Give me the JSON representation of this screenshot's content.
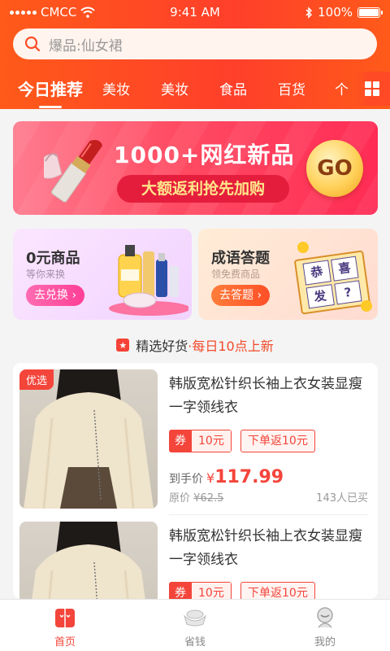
{
  "status_bar": {
    "carrier": "CMCC",
    "time": "9:41 AM",
    "battery": "100%"
  },
  "search": {
    "placeholder": "爆品:仙女裙"
  },
  "tabs": [
    {
      "label": "今日推荐",
      "active": true
    },
    {
      "label": "美妆"
    },
    {
      "label": "美妆"
    },
    {
      "label": "食品"
    },
    {
      "label": "百货"
    },
    {
      "label": "个"
    }
  ],
  "banner": {
    "title": "1000+网红新品",
    "subtitle": "大额返利抢先加购",
    "go_label": "GO"
  },
  "cards": [
    {
      "title": "0元商品",
      "subtitle": "等你来换",
      "button": "去兑换 ›"
    },
    {
      "title": "成语答题",
      "subtitle": "领免费商品",
      "button": "去答题 ›",
      "puzzle_chars": [
        "恭",
        "喜",
        "发",
        "?"
      ]
    }
  ],
  "section": {
    "title": "精选好货",
    "highlight": "·每日10点上新"
  },
  "products": [
    {
      "tag": "优选",
      "name": "韩版宽松针织长袖上衣女装显瘦一字领线衣",
      "coupon_label": "券",
      "coupon_value": "10元",
      "rebate": "下单返10元",
      "final_price_label": "到手价",
      "currency": "¥",
      "final_price": "117.99",
      "original_label": "原价",
      "original_price": "¥62.5",
      "sold": "143人已买"
    },
    {
      "name": "韩版宽松针织长袖上衣女装显瘦一字领线衣",
      "coupon_label": "券",
      "coupon_value": "10元",
      "rebate": "下单返10元"
    }
  ],
  "bottom_nav": [
    {
      "label": "首页",
      "active": true
    },
    {
      "label": "省钱"
    },
    {
      "label": "我的"
    }
  ],
  "colors": {
    "primary": "#ff4a25",
    "price": "#f4453b",
    "banner": "#ff2c55"
  }
}
